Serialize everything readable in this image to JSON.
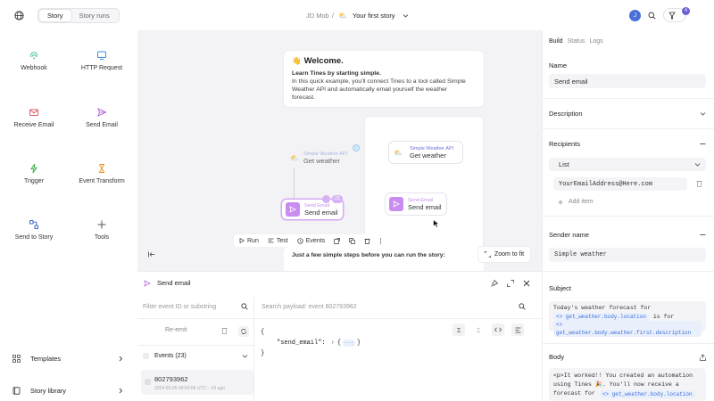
{
  "topbar": {
    "tabs": [
      {
        "label": "Story",
        "active": true
      },
      {
        "label": "Story runs",
        "active": false
      }
    ],
    "breadcrumb_parent": "JD Mob",
    "breadcrumb_sep": "/",
    "story_name": "Your first story",
    "avatar_initial": "J",
    "notif_count": "4"
  },
  "palette": {
    "tools": [
      {
        "label": "Webhook",
        "icon": "webhook-icon",
        "color": "#3fb89a"
      },
      {
        "label": "HTTP Request",
        "icon": "monitor-icon",
        "color": "#3b8ed8"
      },
      {
        "label": "Receive Email",
        "icon": "mail-icon",
        "color": "#e25b6a"
      },
      {
        "label": "Send Email",
        "icon": "send-icon",
        "color": "#b36ad9"
      },
      {
        "label": "Trigger",
        "icon": "lightning-icon",
        "color": "#37b24d"
      },
      {
        "label": "Event Transform",
        "icon": "hourglass-icon",
        "color": "#e6912e"
      },
      {
        "label": "Send to Story",
        "icon": "story-icon",
        "color": "#3a63c7"
      },
      {
        "label": "Tools",
        "icon": "plus-icon",
        "color": "#555555"
      }
    ],
    "templates_label": "Templates",
    "library_label": "Story library"
  },
  "canvas": {
    "welcome_emoji": "👋",
    "welcome_title": "Welcome.",
    "welcome_lead": "Learn Tines by starting simple.",
    "welcome_body": "In this quick example, you'll connect Tines to a tool called Simple Weather API and automatically email yourself the weather forecast.",
    "node_a_type": "Simple Weather API",
    "node_a_name": "Get weather",
    "node_b_type": "Send Email",
    "node_b_name": "Send email",
    "node_b_badge": "21",
    "node_c_type": "Simple Weather API",
    "node_c_name": "Get weather",
    "node_d_type": "Send Email",
    "node_d_name": "Send email",
    "toolbar": {
      "run": "Run",
      "test": "Test",
      "events": "Events"
    },
    "steps_text": "Just a few simple steps before you can run the story:",
    "zoom_label": "Zoom to fit"
  },
  "bottom": {
    "title": "Send email",
    "filter_placeholder": "Filter event ID or substring",
    "search_placeholder": "Search payload: event 802793962",
    "reemit_label": "Re-emit",
    "events_label": "Events (23)",
    "event_id": "802793962",
    "event_time": "2024-03-05 09:50:06 UTC – 29 ago",
    "json_open": "{",
    "json_key": "\"send_email\":",
    "json_arrow": "›",
    "json_val_open": "{",
    "json_ellipsis": "···",
    "json_val_close": "}",
    "json_close": "}"
  },
  "right": {
    "tabs": [
      {
        "label": "Build",
        "active": true
      },
      {
        "label": "Status",
        "active": false
      },
      {
        "label": "Logs",
        "active": false
      }
    ],
    "name_label": "Name",
    "name_value": "Send email",
    "description_label": "Description",
    "recipients_label": "Recipients",
    "list_label": "List",
    "recipient_value": "YourEmailAddress@Here.com",
    "add_item_label": "Add item",
    "sender_label": "Sender name",
    "sender_value": "Simple weather",
    "subject_label": "Subject",
    "subject_line1": "Today's weather forecast for",
    "subject_chip1": "<> get_weather.body.location",
    "subject_is_for": "is for",
    "subject_chip2": "<> get_weather.body.weather.first.description",
    "body_label": "Body",
    "body_line1": "<p>It worked!! You created an automation",
    "body_line2": "using Tines 🎉. You'll now receive a",
    "body_line3": "forecast for",
    "body_chip": "<> get_weather.body.location"
  }
}
